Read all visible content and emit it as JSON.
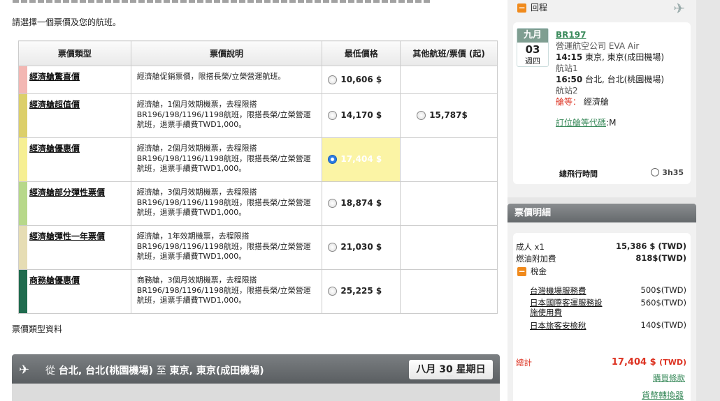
{
  "instruction": "請選擇一個票價及您的航班。",
  "table": {
    "headers": [
      "票價類型",
      "票價說明",
      "最低價格",
      "其他航班/票價 (起)"
    ],
    "rows": [
      {
        "name": "經濟艙驚喜價",
        "color": "#f3b7b3",
        "desc": "經濟艙促銷票價，限搭長榮/立榮營運航班。",
        "price": "10,606 $",
        "other": "",
        "selected": false
      },
      {
        "name": "經濟艙超值價",
        "color": "#dccf6a",
        "desc": "經濟艙，1個月效期機票，去程限搭BR196/198/1196/1198航班，限搭長榮/立榮營運航班，退票手續費TWD1,000。",
        "price": "14,170 $",
        "other": "15,787$",
        "selected": false
      },
      {
        "name": "經濟艙優惠價",
        "color": "#f6ef93",
        "desc": "經濟艙，2個月效期機票，去程限搭BR196/198/1196/1198航班，限搭長榮/立榮營運航班，退票手續費TWD1,000。",
        "price": "17,404 $",
        "other": "",
        "selected": true
      },
      {
        "name": "經濟艙部分彈性票價",
        "color": "#b7d88a",
        "desc": "經濟艙，3個月效期機票，去程限搭BR196/198/1196/1198航班，限搭長榮/立榮營運航班，退票手續費TWD1,000。",
        "price": "18,874 $",
        "other": "",
        "selected": false
      },
      {
        "name": "經濟艙彈性一年票價",
        "color": "#e6ddb4",
        "desc": "經濟艙，1年效期機票，去程限搭BR196/198/1196/1198航班，限搭長榮/立榮營運航班，退票手續費TWD1,000。",
        "price": "21,030 $",
        "other": "",
        "selected": false
      },
      {
        "name": "商務艙優惠價",
        "color": "#1f6b4e",
        "desc": "商務艙，3個月效期機票，去程限搭BR196/198/1196/1198航班，限搭長榮/立榮營運航班，退票手續費TWD1,000。",
        "price": "25,225 $",
        "other": "",
        "selected": false
      }
    ]
  },
  "fare_info_label": "票價類型資料",
  "route_bar": {
    "from_word": "從",
    "from": "台北, 台北(桃園機場)",
    "to_word": "至",
    "to": "東京, 東京(成田機場)",
    "date_prefix": "八月",
    "date_day": "30",
    "date_weekday": "星期日"
  },
  "return": {
    "title": "回程",
    "month": "九月",
    "day": "03",
    "weekday": "週四",
    "flight_no": "BR197",
    "carrier": "營運航空公司  EVA Air",
    "dep_time": "14:15",
    "dep_place": "東京, 東京(成田機場)",
    "dep_terminal": "航站1",
    "arr_time": "16:50",
    "arr_place": "台北, 台北(桃園機場)",
    "arr_terminal": "航站2",
    "cabin_label": "艙等：",
    "cabin": "經濟艙",
    "booking_label": "訂位艙等代碼",
    "booking_code": "M",
    "total_time_label": "總飛行時間",
    "total_time": "3h35"
  },
  "price_detail": {
    "title": "票價明細",
    "adult_label": "成人",
    "adult_count": "x1",
    "adult_price": "15,386 $ (TWD)",
    "fuel_label": "燃油附加費",
    "fuel_price": "818$(TWD)",
    "tax_label": "稅金",
    "taxes": [
      {
        "label": "台灣機場服務費",
        "value": "500$(TWD)"
      },
      {
        "label": "日本國際客運服務設施使用費",
        "value": "560$(TWD)"
      },
      {
        "label": "日本旅客安檢稅",
        "value": "140$(TWD)"
      }
    ],
    "total_label": "總計",
    "total_value": "17,404 $",
    "total_unit": "(TWD)",
    "terms_link": "購買條款",
    "converter_link": "貨幣轉換器"
  }
}
